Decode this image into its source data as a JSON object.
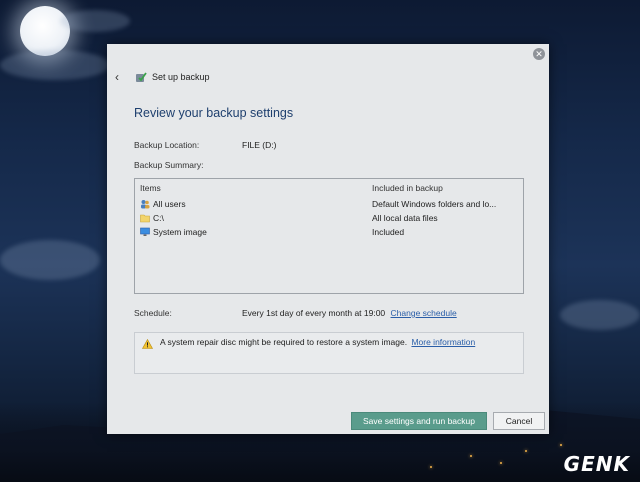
{
  "window": {
    "title": "Set up backup",
    "heading": "Review your backup settings"
  },
  "settings": {
    "location_label": "Backup Location:",
    "location_value": "FILE (D:)",
    "summary_label": "Backup Summary:",
    "schedule_label": "Schedule:",
    "schedule_value": "Every 1st day of every month at 19:00",
    "change_schedule_link": "Change schedule"
  },
  "summary_table": {
    "columns": [
      "Items",
      "Included in backup"
    ],
    "rows": [
      {
        "item": "All users",
        "icon": "users-icon",
        "included": "Default Windows folders and lo..."
      },
      {
        "item": "C:\\",
        "icon": "folder-icon",
        "included": "All local data files"
      },
      {
        "item": "System image",
        "icon": "monitor-icon",
        "included": "Included"
      }
    ]
  },
  "warning": {
    "text": "A system repair disc might be required to restore a system image.",
    "link": "More information"
  },
  "buttons": {
    "primary": "Save settings and run backup",
    "cancel": "Cancel"
  },
  "branding": {
    "logo_text": "GENK"
  },
  "colors": {
    "heading": "#1e3f6e",
    "link": "#2a5ea8",
    "primary_button": "#5a9c8c"
  }
}
